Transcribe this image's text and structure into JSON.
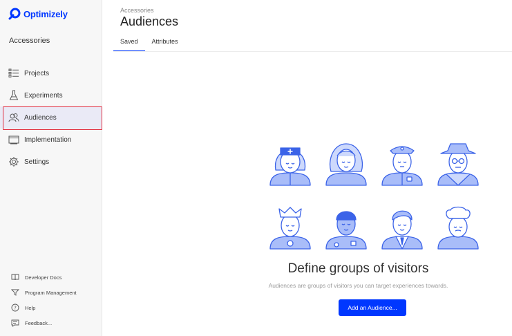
{
  "app": {
    "logo_text": "Optimizely",
    "project_name": "Accessories"
  },
  "sidebar": {
    "items": [
      {
        "label": "Projects",
        "icon": "projects-list-icon"
      },
      {
        "label": "Experiments",
        "icon": "flask-icon"
      },
      {
        "label": "Audiences",
        "icon": "people-icon",
        "active": true
      },
      {
        "label": "Implementation",
        "icon": "browser-window-icon"
      },
      {
        "label": "Settings",
        "icon": "gear-icon"
      }
    ],
    "bottom": [
      {
        "label": "Developer Docs",
        "icon": "book-icon"
      },
      {
        "label": "Program Management",
        "icon": "funnel-icon"
      },
      {
        "label": "Help",
        "icon": "question-circle-icon"
      },
      {
        "label": "Feedback...",
        "icon": "chat-bubble-icon"
      }
    ]
  },
  "header": {
    "breadcrumb": "Accessories",
    "title": "Audiences"
  },
  "tabs": [
    {
      "label": "Saved",
      "active": true
    },
    {
      "label": "Attributes",
      "active": false
    }
  ],
  "empty_state": {
    "title": "Define groups of visitors",
    "description": "Audiences are groups of visitors you can target experiences towards.",
    "button_label": "Add an Audience..."
  },
  "colors": {
    "brand": "#0037ff",
    "illustration": "#a9bdf9",
    "illustration_stroke": "#3b63e8",
    "highlight_border": "#e02a3b"
  }
}
